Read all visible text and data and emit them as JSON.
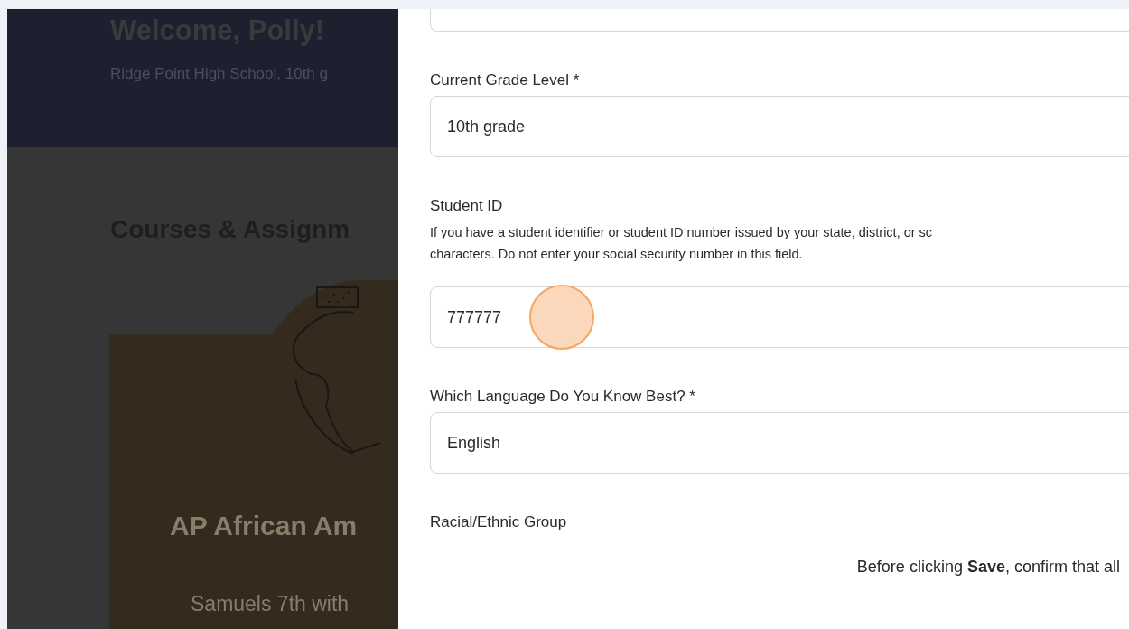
{
  "background_page": {
    "welcome": "Welcome, Polly!",
    "school": "Ridge Point High School, 10th g",
    "section_title": "Courses & Assignm",
    "course": {
      "title": "AP African Am",
      "teacher": "Samuels 7th with"
    }
  },
  "form": {
    "fields": [
      {
        "kind": "partial"
      },
      {
        "kind": "text",
        "label": "Current Grade Level *",
        "value": "10th grade"
      },
      {
        "kind": "text",
        "label": "Student ID",
        "help": [
          "If you have a student identifier or student ID number issued by your state, district, or sc",
          "characters. Do not enter your social security number in this field."
        ],
        "value": "777777"
      },
      {
        "kind": "text",
        "label": "Which Language Do You Know Best? *",
        "value": "English"
      },
      {
        "kind": "label",
        "label": "Racial/Ethnic Group"
      }
    ],
    "footer": "Before clicking **Save**, confirm that all"
  }
}
